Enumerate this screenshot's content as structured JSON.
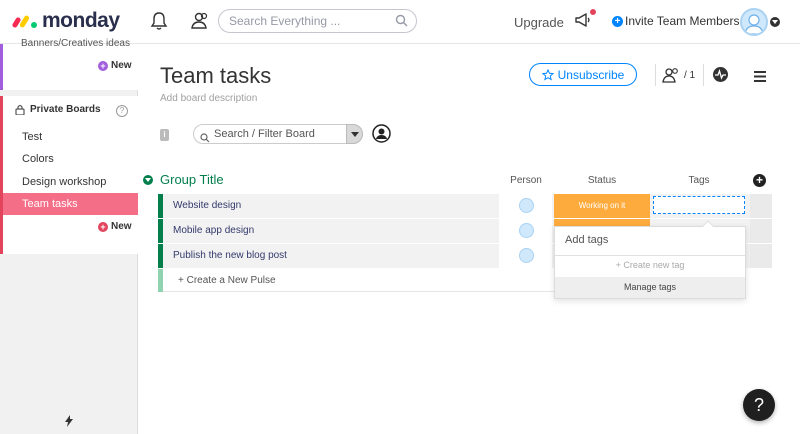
{
  "header": {
    "logo_text": "monday",
    "search_placeholder": "Search Everything ...",
    "upgrade_label": "Upgrade",
    "invite_label": "Invite Team Members"
  },
  "sidebar": {
    "cut_item": "Banners/Creatives ideas",
    "new_label_top": "New",
    "private_boards_title": "Private Boards",
    "help_mark": "?",
    "items": [
      {
        "label": "Test"
      },
      {
        "label": "Colors"
      },
      {
        "label": "Design workshop"
      },
      {
        "label": "Team tasks",
        "active": true
      }
    ],
    "new_label_private": "New"
  },
  "board": {
    "title": "Team tasks",
    "description": "Add board description",
    "unsubscribe_label": "Unsubscribe",
    "members_count": "/ 1",
    "info_mark": "i",
    "filter_placeholder": "Search / Filter Board"
  },
  "group": {
    "title": "Group Title",
    "columns": {
      "person": "Person",
      "status": "Status",
      "tags": "Tags"
    },
    "add_column": "+",
    "rows": [
      {
        "name": "Website design",
        "status": "Working on it"
      },
      {
        "name": "Mobile app design",
        "status": ""
      },
      {
        "name": "Publish the new blog post",
        "status": ""
      }
    ],
    "create_pulse": "+ Create a New Pulse"
  },
  "tags_popup": {
    "input_placeholder": "Add tags",
    "create_tag": "+ Create new tag",
    "manage_tags": "Manage tags"
  },
  "help_button": "?",
  "colors": {
    "accent": "#0085ff",
    "group_green": "#037f4c",
    "status_orange": "#fdab3d",
    "active_board": "#f56e87"
  }
}
